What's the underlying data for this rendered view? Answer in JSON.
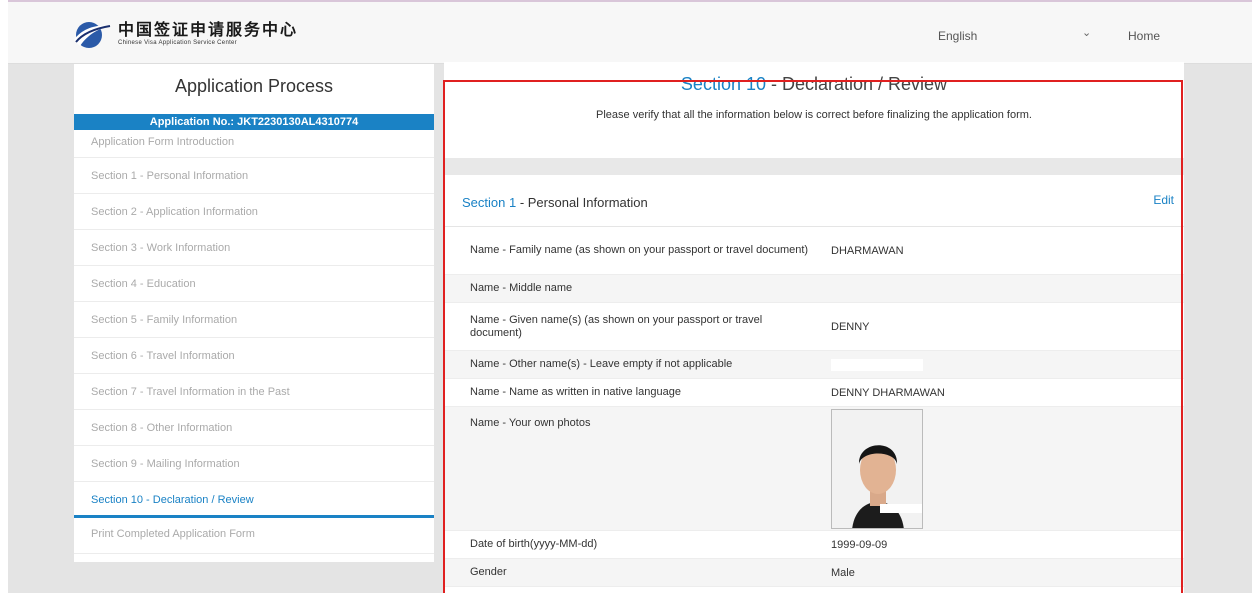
{
  "header": {
    "logo_cn": "中国签证申请服务中心",
    "logo_en": "Chinese Visa Application Service Center",
    "language": "English",
    "home_label": "Home"
  },
  "sidebar": {
    "title": "Application Process",
    "application_no": "Application No.: JKT2230130AL4310774",
    "items": [
      {
        "label": "Application Form Introduction"
      },
      {
        "label": "Section 1 - Personal Information"
      },
      {
        "label": "Section 2 - Application Information"
      },
      {
        "label": "Section 3 - Work Information"
      },
      {
        "label": "Section 4 - Education"
      },
      {
        "label": "Section 5 - Family Information"
      },
      {
        "label": "Section 6 - Travel Information"
      },
      {
        "label": "Section 7 - Travel Information in the Past"
      },
      {
        "label": "Section 8 - Other Information"
      },
      {
        "label": "Section 9 - Mailing Information"
      },
      {
        "label": "Section 10 - Declaration / Review"
      },
      {
        "label": "Print Completed Application Form"
      }
    ]
  },
  "main": {
    "title_num": "Section 10",
    "title_rest": " - Declaration / Review",
    "subtitle": "Please verify that all the information below is correct before finalizing the application form.",
    "section": {
      "num": "Section 1",
      "rest": " - Personal Information",
      "edit_label": "Edit"
    },
    "rows": [
      {
        "label": "Name - Family name (as shown on your passport or travel document)",
        "value": "DHARMAWAN"
      },
      {
        "label": "Name - Middle name",
        "value": ""
      },
      {
        "label": "Name - Given name(s) (as shown on your passport or travel document)",
        "value": "DENNY"
      },
      {
        "label": "Name - Other name(s) - Leave empty if not applicable",
        "value": ""
      },
      {
        "label": "Name - Name as written in native language",
        "value": "DENNY DHARMAWAN"
      },
      {
        "label": "Name - Your own photos",
        "value": ""
      },
      {
        "label": "Date of birth(yyyy-MM-dd)",
        "value": "1999-09-09"
      },
      {
        "label": "Gender",
        "value": "Male"
      }
    ]
  },
  "colors": {
    "accent": "#1a82c5",
    "highlight_frame": "#e02020"
  }
}
